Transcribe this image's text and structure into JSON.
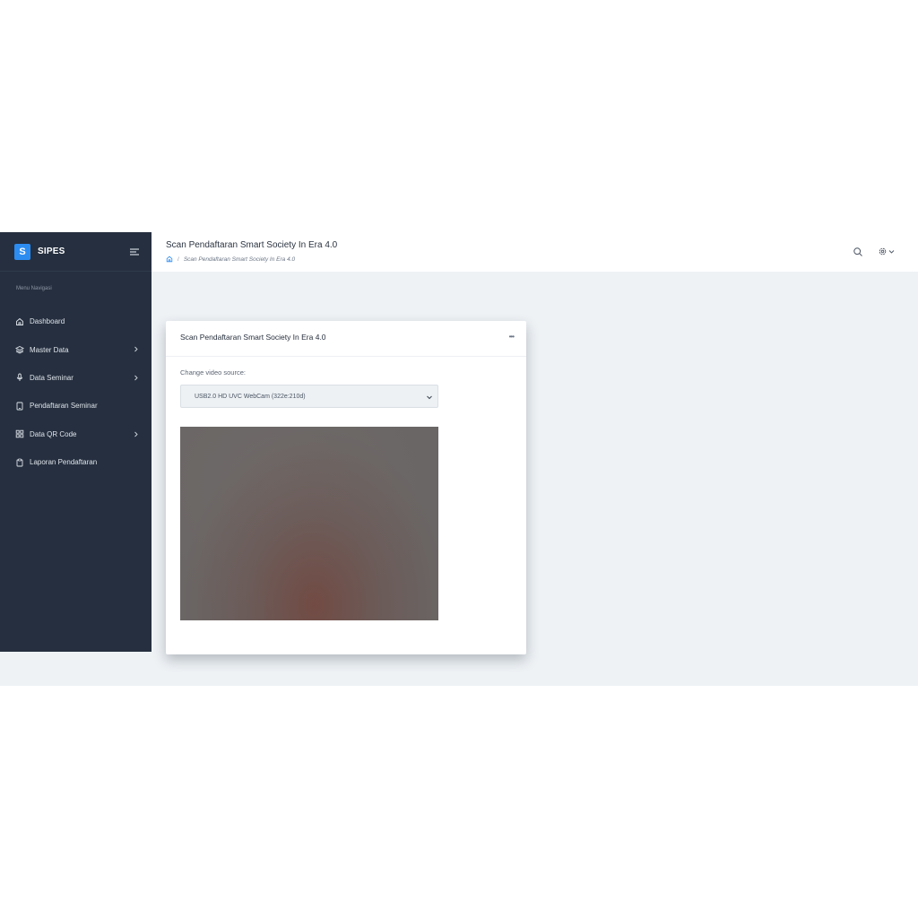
{
  "brand": {
    "logo_letter": "S",
    "name": "SIPES"
  },
  "sidebar": {
    "caption": "Menu Navigasi",
    "items": [
      {
        "label": "Dashboard",
        "icon": "home-icon",
        "has_children": false
      },
      {
        "label": "Master Data",
        "icon": "layers-icon",
        "has_children": true
      },
      {
        "label": "Data Seminar",
        "icon": "microphone-icon",
        "has_children": true
      },
      {
        "label": "Pendaftaran Seminar",
        "icon": "tablet-icon",
        "has_children": false
      },
      {
        "label": "Data QR Code",
        "icon": "grid-icon",
        "has_children": true
      },
      {
        "label": "Laporan Pendaftaran",
        "icon": "clipboard-icon",
        "has_children": false
      }
    ]
  },
  "header": {
    "title": "Scan Pendaftaran Smart Society In Era 4.0",
    "breadcrumb": {
      "separator": "/",
      "current": "Scan Pendaftaran Smart Society In Era 4.0"
    }
  },
  "card": {
    "title": "Scan Pendaftaran Smart Society In Era 4.0",
    "menu_glyph": "•••",
    "video_source_label": "Change video source:",
    "video_source_selected": "USB2.0 HD UVC WebCam (322e:210d)"
  },
  "colors": {
    "sidebar_bg": "#252f3f",
    "brand_accent": "#2d8cf0",
    "content_bg": "#eef2f5"
  }
}
